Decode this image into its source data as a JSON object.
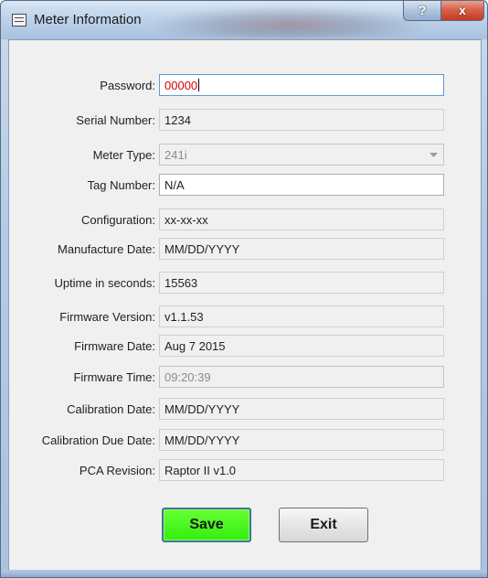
{
  "window": {
    "title": "Meter Information"
  },
  "caption_buttons": {
    "help": "?",
    "close": "x"
  },
  "fields": [
    {
      "label": "Password:",
      "value": "00000"
    },
    {
      "label": "Serial Number:",
      "value": "1234"
    },
    {
      "label": "Meter Type:",
      "value": "241i"
    },
    {
      "label": "Tag Number:",
      "value": "N/A"
    },
    {
      "label": "Configuration:",
      "value": "xx-xx-xx"
    },
    {
      "label": "Manufacture Date:",
      "value": "MM/DD/YYYY"
    },
    {
      "label": "Uptime in seconds:",
      "value": "15563"
    },
    {
      "label": "Firmware Version:",
      "value": "v1.1.53"
    },
    {
      "label": "Firmware Date:",
      "value": "Aug  7 2015"
    },
    {
      "label": "Firmware Time:",
      "value": "09:20:39"
    },
    {
      "label": "Calibration Date:",
      "value": "MM/DD/YYYY"
    },
    {
      "label": "Calibration Due Date:",
      "value": "MM/DD/YYYY"
    },
    {
      "label": "PCA Revision:",
      "value": "Raptor II v1.0"
    }
  ],
  "buttons": {
    "save": "Save",
    "exit": "Exit"
  },
  "colors": {
    "save_button": "#33ee11",
    "password_text": "#e00000"
  }
}
